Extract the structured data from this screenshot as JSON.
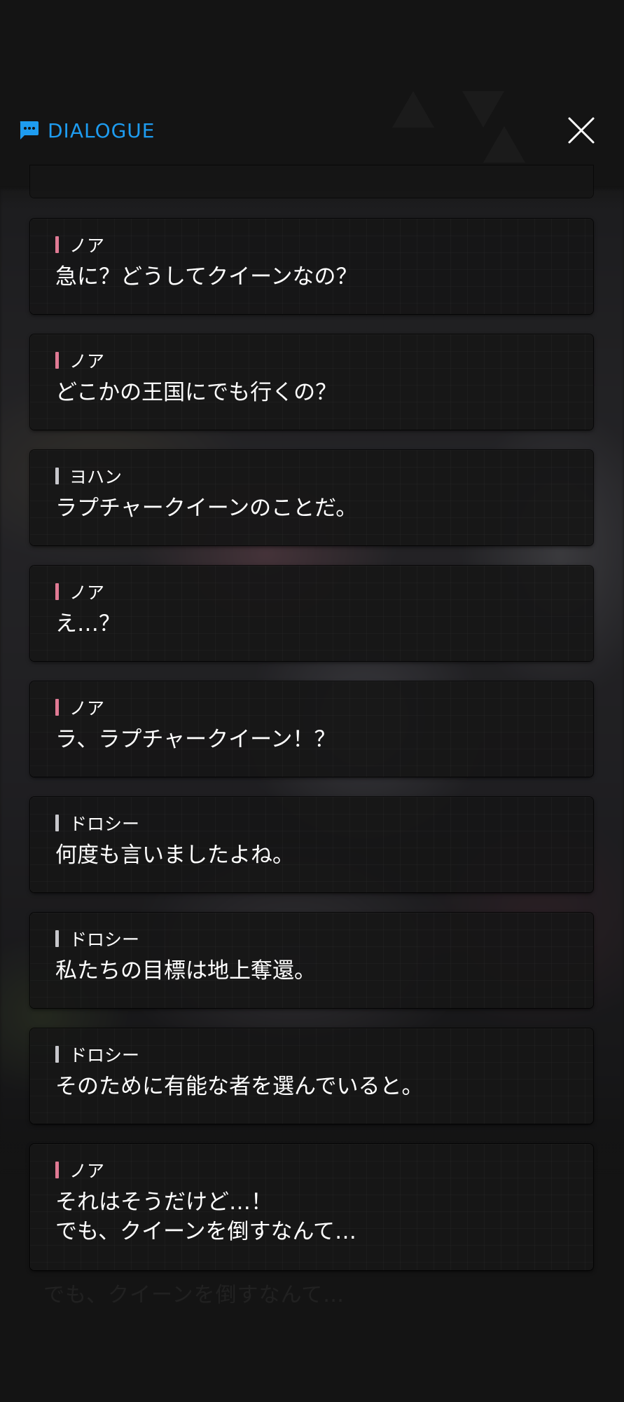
{
  "header": {
    "title": "DIALOGUE",
    "icon": "chat-bubble-icon",
    "accent_color": "#1e9cf0",
    "close_icon": "close-icon"
  },
  "speaker_colors": {
    "pink": "#e07a94",
    "gray": "#c7c7cc"
  },
  "dialogue": [
    {
      "speaker": "ノア",
      "color": "pink",
      "text": "急に？どうしてクイーンなの？"
    },
    {
      "speaker": "ノア",
      "color": "pink",
      "text": "どこかの王国にでも行くの？"
    },
    {
      "speaker": "ヨハン",
      "color": "gray",
      "text": "ラプチャークイーンのことだ。"
    },
    {
      "speaker": "ノア",
      "color": "pink",
      "text": "え…？"
    },
    {
      "speaker": "ノア",
      "color": "pink",
      "text": "ラ、ラプチャークイーン！？"
    },
    {
      "speaker": "ドロシー",
      "color": "gray",
      "text": "何度も言いましたよね。"
    },
    {
      "speaker": "ドロシー",
      "color": "gray",
      "text": "私たちの目標は地上奪還。"
    },
    {
      "speaker": "ドロシー",
      "color": "gray",
      "text": "そのために有能な者を選んでいると。"
    },
    {
      "speaker": "ノア",
      "color": "pink",
      "text": "それはそうだけど…！\nでも、クイーンを倒すなんて…"
    }
  ],
  "background_subtitle": "でも、クイーンを倒すなんて…"
}
